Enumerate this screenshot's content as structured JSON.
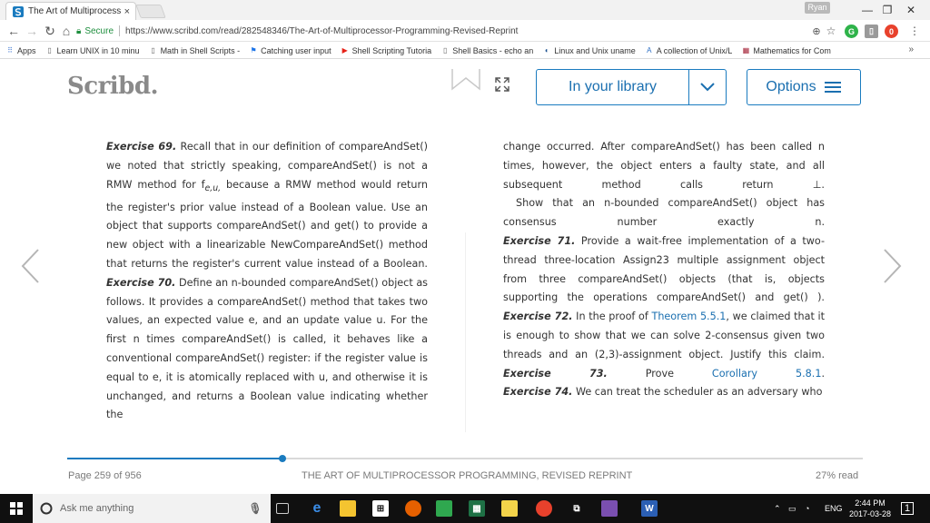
{
  "browser": {
    "tab_title": "The Art of Multiprocesso",
    "tab_close": "×",
    "user_badge": "Ryan",
    "win_minimize": "—",
    "win_maximize": "❐",
    "win_close": "✕",
    "secure_label": "Secure",
    "url": "https://www.scribd.com/read/282548346/The-Art-of-Multiprocessor-Programming-Revised-Reprint",
    "bookmarks": [
      {
        "label": "Apps",
        "icon": "apps-icon",
        "color": "#4a7fd6"
      },
      {
        "label": "Learn UNIX in 10 minu",
        "icon": "page-icon",
        "color": "#666666"
      },
      {
        "label": "Math in Shell Scripts -",
        "icon": "page-icon",
        "color": "#666666"
      },
      {
        "label": "Catching user input",
        "icon": "flag-icon",
        "color": "#1a73e8"
      },
      {
        "label": "Shell Scripting Tutoria",
        "icon": "youtube-icon",
        "color": "#e62117"
      },
      {
        "label": "Shell Basics - echo an",
        "icon": "page-icon",
        "color": "#666666"
      },
      {
        "label": "Linux and Unix uname",
        "icon": "linux-icon",
        "color": "#1a4f8f"
      },
      {
        "label": "A collection of Unix/L",
        "icon": "a-icon",
        "color": "#2d6fc4"
      },
      {
        "label": "Mathematics for Com",
        "icon": "mit-icon",
        "color": "#a31f34"
      }
    ],
    "bookmarks_more": "»"
  },
  "scribd": {
    "logo": "Scribd.",
    "library_label": "In your library",
    "options_label": "Options"
  },
  "document": {
    "left_column": [
      {
        "ex": "Exercise 69.",
        "text": " Recall that in our definition of compareAndSet() we noted that strictly speaking, compareAndSet() is not a RMW method for f",
        "sub": "e,u,",
        "tail": " because a RMW method would return the register's prior value instead of a Boolean value. Use an object that supports compareAndSet() and get() to provide a new object with a linearizable NewCompareAndSet() method that returns the register's current value instead of a Boolean."
      },
      {
        "ex": "Exercise 70.",
        "text": " Define an n-bounded compareAndSet() object as follows. It provides a compareAndSet() method that takes two values, an expected value e, and an update value u. For the first n times compareAndSet() is called, it behaves like a conventional compareAndSet() register: if the register value is equal to e, it is atomically replaced with u, and otherwise it is unchanged, and returns a Boolean value indicating whether the"
      }
    ],
    "right_column": [
      {
        "ex": "",
        "text": "change occurred. After compareAndSet() has been called n times, however, the object enters a faulty state, and all subsequent method calls return ⊥."
      },
      {
        "ex": "",
        "text": "Show that an n-bounded compareAndSet() object has consensus number exactly n.",
        "indent": true
      },
      {
        "ex": "Exercise 71.",
        "text": " Provide a wait-free implementation of a two-thread three-location Assign23 multiple assignment object from three compareAndSet() objects (that is, objects supporting the operations compareAndSet() and get() )."
      },
      {
        "ex": "Exercise 72.",
        "text": " In the proof of ",
        "link": "Theorem 5.5.1",
        "tail": ", we claimed that it is enough to show that we can solve 2-consensus given two threads and an (2,3)-assignment object. Justify this claim."
      },
      {
        "ex": "Exercise 73.",
        "text": " Prove ",
        "link": "Corollary 5.8.1",
        "tail": "."
      },
      {
        "ex": "Exercise 74.",
        "text": " We can treat the scheduler as an adversary who"
      }
    ]
  },
  "footer": {
    "page_label": "Page 259 of 956",
    "book_title": "THE ART OF MULTIPROCESSOR PROGRAMMING, REVISED REPRINT",
    "percent_read": "27% read",
    "progress": 0.27
  },
  "taskbar": {
    "search_placeholder": "Ask me anything",
    "lang": "ENG",
    "time": "2:44 PM",
    "date": "2017-03-28",
    "notification_count": "1"
  },
  "colors": {
    "accent": "#1a7bbf",
    "secure_green": "#1e8e3e",
    "link": "#1a6fb0"
  }
}
